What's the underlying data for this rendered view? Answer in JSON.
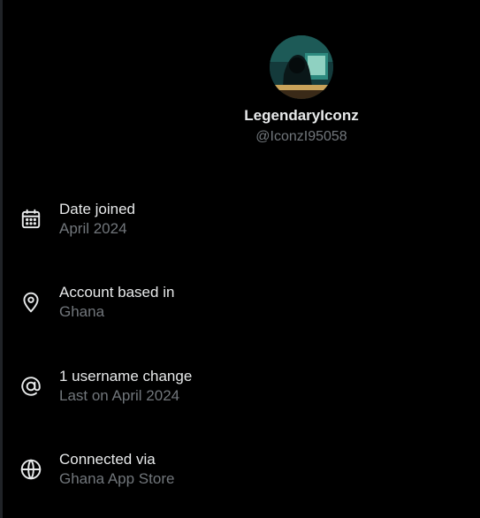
{
  "profile": {
    "display_name": "LegendaryIconz",
    "handle": "@IconzI95058"
  },
  "details": [
    {
      "icon": "calendar-icon",
      "label": "Date joined",
      "value": "April 2024"
    },
    {
      "icon": "location-pin-icon",
      "label": "Account based in",
      "value": "Ghana"
    },
    {
      "icon": "at-sign-icon",
      "label": "1 username change",
      "value": "Last on April 2024"
    },
    {
      "icon": "globe-icon",
      "label": "Connected via",
      "value": "Ghana App Store"
    }
  ],
  "colors": {
    "background": "#000000",
    "primary_text": "#e7e9ea",
    "secondary_text": "#71767b"
  }
}
